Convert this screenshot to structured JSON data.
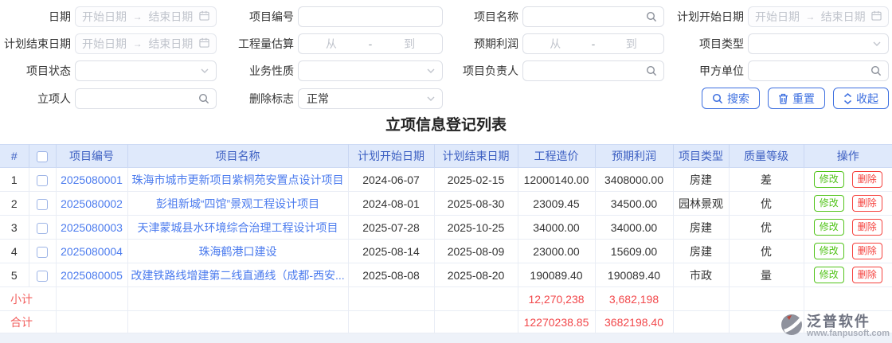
{
  "form": {
    "daterange": {
      "start": "开始日期",
      "arrow": "→",
      "end": "结束日期"
    },
    "range": {
      "from": "从",
      "dash": "-",
      "to": "到"
    },
    "date": {
      "label": "日期"
    },
    "project_code": {
      "label": "项目编号"
    },
    "project_name": {
      "label": "项目名称"
    },
    "plan_start": {
      "label": "计划开始日期"
    },
    "plan_end": {
      "label": "计划结束日期"
    },
    "quantity_estimate": {
      "label": "工程量估算"
    },
    "expected_profit": {
      "label": "预期利润"
    },
    "project_type": {
      "label": "项目类型"
    },
    "project_status": {
      "label": "项目状态"
    },
    "business_nature": {
      "label": "业务性质"
    },
    "project_manager": {
      "label": "项目负责人"
    },
    "client_unit": {
      "label": "甲方单位"
    },
    "initiator": {
      "label": "立项人"
    },
    "delete_flag": {
      "label": "删除标志",
      "value": "正常"
    }
  },
  "toolbar": {
    "search": "搜索",
    "reset": "重置",
    "collapse": "收起"
  },
  "title": "立项信息登记列表",
  "table": {
    "headers": {
      "index": "#",
      "code": "项目编号",
      "name": "项目名称",
      "plan_start": "计划开始日期",
      "plan_end": "计划结束日期",
      "cost": "工程造价",
      "profit": "预期利润",
      "type": "项目类型",
      "grade": "质量等级",
      "ops": "操作"
    },
    "actions": {
      "edit": "修改",
      "delete": "删除"
    },
    "rows": [
      {
        "index": "1",
        "code": "2025080001",
        "name": "珠海市城市更新项目紫桐苑安置点设计项目",
        "plan_start": "2024-06-07",
        "plan_end": "2025-02-15",
        "cost": "12000140.00",
        "profit": "3408000.00",
        "type": "房建",
        "grade": "差"
      },
      {
        "index": "2",
        "code": "2025080002",
        "name": "彭祖新城“四馆”景观工程设计项目",
        "plan_start": "2024-08-01",
        "plan_end": "2025-08-30",
        "cost": "23009.45",
        "profit": "34500.00",
        "type": "园林景观",
        "grade": "优"
      },
      {
        "index": "3",
        "code": "2025080003",
        "name": "天津蒙城县水环境综合治理工程设计项目",
        "plan_start": "2025-07-28",
        "plan_end": "2025-10-25",
        "cost": "34000.00",
        "profit": "34000.00",
        "type": "房建",
        "grade": "优"
      },
      {
        "index": "4",
        "code": "2025080004",
        "name": "珠海鹤港口建设",
        "plan_start": "2025-08-14",
        "plan_end": "2025-08-09",
        "cost": "23000.00",
        "profit": "15609.00",
        "type": "房建",
        "grade": "优"
      },
      {
        "index": "5",
        "code": "2025080005",
        "name": "改建铁路线增建第二线直通线（成都-西安...",
        "plan_start": "2025-08-08",
        "plan_end": "2025-08-20",
        "cost": "190089.40",
        "profit": "190089.40",
        "type": "市政",
        "grade": "量"
      }
    ],
    "subtotal": {
      "label": "小计",
      "cost": "12,270,238",
      "profit": "3,682,198"
    },
    "total": {
      "label": "合计",
      "cost": "12270238.85",
      "profit": "3682198.40"
    }
  },
  "watermark": {
    "brand": "泛普软件",
    "site": "www.fanpusoft.com"
  },
  "colors": {
    "accent_blue": "#3d6fe0",
    "header_bg": "#dfe9fb",
    "header_text": "#3c5fc2",
    "link_blue": "#4b7bee",
    "red": "#f2484b",
    "green": "#52c41a",
    "del_red": "#f5413d"
  }
}
